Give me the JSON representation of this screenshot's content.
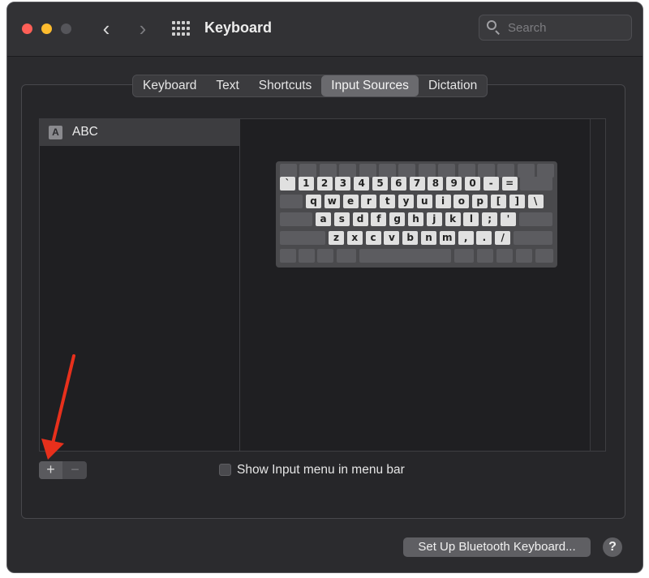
{
  "window": {
    "title": "Keyboard",
    "search_placeholder": "Search"
  },
  "tabs": [
    {
      "label": "Keyboard",
      "active": false
    },
    {
      "label": "Text",
      "active": false
    },
    {
      "label": "Shortcuts",
      "active": false
    },
    {
      "label": "Input Sources",
      "active": true
    },
    {
      "label": "Dictation",
      "active": false
    }
  ],
  "input_sources": [
    {
      "badge": "A",
      "label": "ABC",
      "selected": true
    }
  ],
  "keyboard_rows": [
    [
      "`",
      "1",
      "2",
      "3",
      "4",
      "5",
      "6",
      "7",
      "8",
      "9",
      "0",
      "-",
      "="
    ],
    [
      "q",
      "w",
      "e",
      "r",
      "t",
      "y",
      "u",
      "i",
      "o",
      "p",
      "[",
      "]",
      "\\"
    ],
    [
      "a",
      "s",
      "d",
      "f",
      "g",
      "h",
      "j",
      "k",
      "l",
      ";",
      "'"
    ],
    [
      "z",
      "x",
      "c",
      "v",
      "b",
      "n",
      "m",
      ",",
      ".",
      "/"
    ]
  ],
  "controls": {
    "add_symbol": "+",
    "remove_symbol": "−",
    "show_input_menu_label": "Show Input menu in menu bar",
    "show_input_menu_checked": false,
    "bluetooth_button": "Set Up Bluetooth Keyboard...",
    "help_symbol": "?"
  },
  "annotation": {
    "color": "#e8301c",
    "target": "add-input-source-button"
  },
  "colors": {
    "window_bg": "#2b2b2e",
    "selected_tab": "#6a6a6e",
    "accent_red": "#fe5f57"
  }
}
